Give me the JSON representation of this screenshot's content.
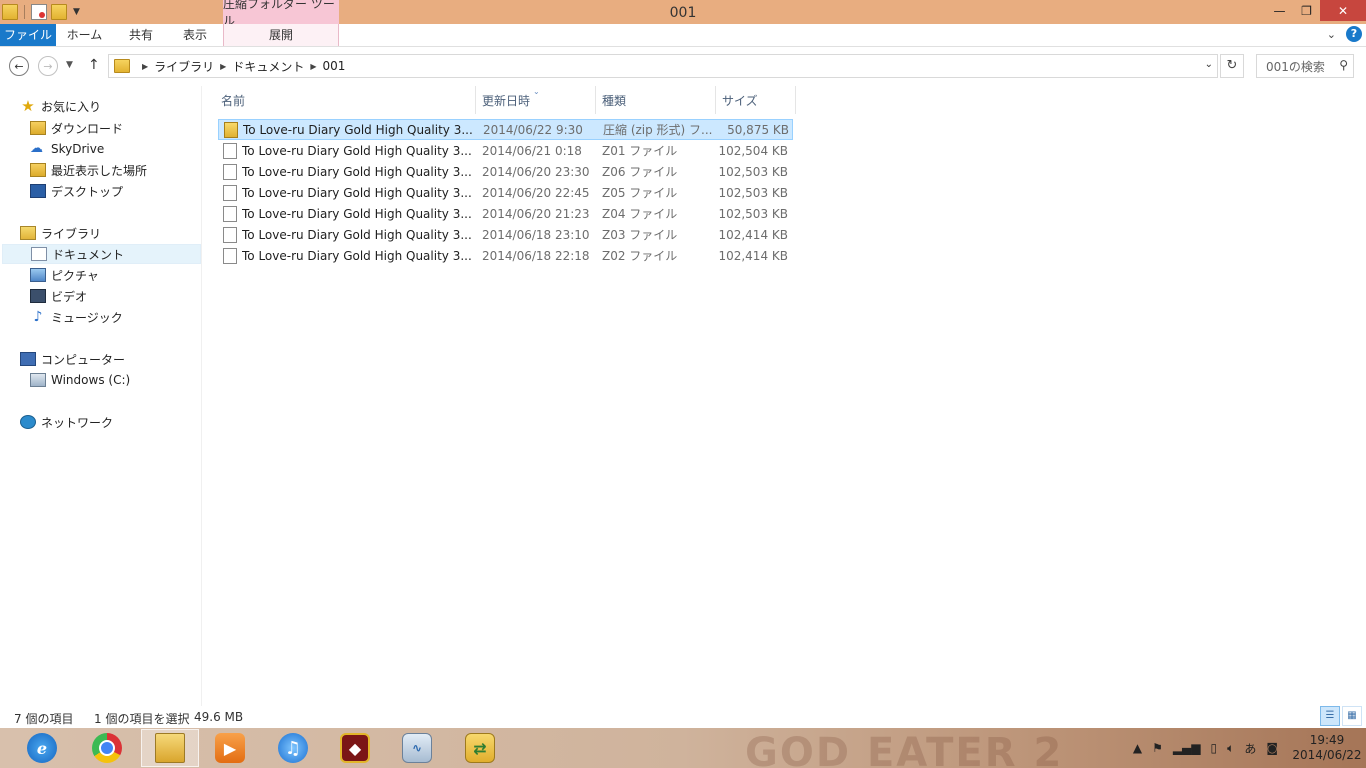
{
  "window": {
    "title": "001",
    "context_tab_group": "圧縮フォルダー ツール",
    "buttons": {
      "minimize": "—",
      "maximize": "❐",
      "close": "✕"
    }
  },
  "ribbon": {
    "tabs": [
      "ファイル",
      "ホーム",
      "共有",
      "表示",
      "展開"
    ],
    "help_label": "?",
    "collapse_label": "⌄"
  },
  "address": {
    "crumbs": [
      "ライブラリ",
      "ドキュメント",
      "001"
    ],
    "search_placeholder": "001の検索",
    "back_label": "←",
    "forward_label": "→",
    "up_label": "↑",
    "refresh_label": "↻"
  },
  "nav_pane": {
    "favorites_label": "お気に入り",
    "favorites": [
      "ダウンロード",
      "SkyDrive",
      "最近表示した場所",
      "デスクトップ"
    ],
    "libraries_label": "ライブラリ",
    "libraries": [
      "ドキュメント",
      "ピクチャ",
      "ビデオ",
      "ミュージック"
    ],
    "computer_label": "コンピューター",
    "computer": [
      "Windows (C:)"
    ],
    "network_label": "ネットワーク"
  },
  "file_list": {
    "columns": [
      "名前",
      "更新日時",
      "種類",
      "サイズ"
    ],
    "rows": [
      {
        "name": "To Love-ru Diary Gold High Quality 3...",
        "date": "2014/06/22 9:30",
        "type": "圧縮 (zip 形式) フ...",
        "size": "50,875 KB",
        "icon": "zip-folder-icon",
        "selected": true
      },
      {
        "name": "To Love-ru Diary Gold High Quality 3...",
        "date": "2014/06/21 0:18",
        "type": "Z01 ファイル",
        "size": "102,504 KB",
        "icon": "blank-file-icon",
        "selected": false
      },
      {
        "name": "To Love-ru Diary Gold High Quality 3...",
        "date": "2014/06/20 23:30",
        "type": "Z06 ファイル",
        "size": "102,503 KB",
        "icon": "blank-file-icon",
        "selected": false
      },
      {
        "name": "To Love-ru Diary Gold High Quality 3...",
        "date": "2014/06/20 22:45",
        "type": "Z05 ファイル",
        "size": "102,503 KB",
        "icon": "blank-file-icon",
        "selected": false
      },
      {
        "name": "To Love-ru Diary Gold High Quality 3...",
        "date": "2014/06/20 21:23",
        "type": "Z04 ファイル",
        "size": "102,503 KB",
        "icon": "blank-file-icon",
        "selected": false
      },
      {
        "name": "To Love-ru Diary Gold High Quality 3...",
        "date": "2014/06/18 23:10",
        "type": "Z03 ファイル",
        "size": "102,414 KB",
        "icon": "blank-file-icon",
        "selected": false
      },
      {
        "name": "To Love-ru Diary Gold High Quality 3...",
        "date": "2014/06/18 22:18",
        "type": "Z02 ファイル",
        "size": "102,414 KB",
        "icon": "blank-file-icon",
        "selected": false
      }
    ]
  },
  "status_bar": {
    "item_count": "7 個の項目",
    "selected": "1 個の項目を選択",
    "selected_size": "49.6 MB"
  },
  "taskbar": {
    "apps": [
      "internet-explorer-icon",
      "chrome-icon",
      "file-explorer-icon",
      "media-player-icon",
      "itunes-icon",
      "game-icon",
      "resource-monitor-icon",
      "folder-sync-icon"
    ],
    "active_app": "file-explorer-icon",
    "wallpaper_text": "GOD EATER 2",
    "ime_label": "あ",
    "clock_time": "19:49",
    "clock_date": "2014/06/22"
  },
  "colors": {
    "titlebar": "#e8ad80",
    "context_tab": "#f7c6d5",
    "file_tab": "#1979ca",
    "selection": "#cce8ff",
    "close_button": "#c7463e"
  }
}
